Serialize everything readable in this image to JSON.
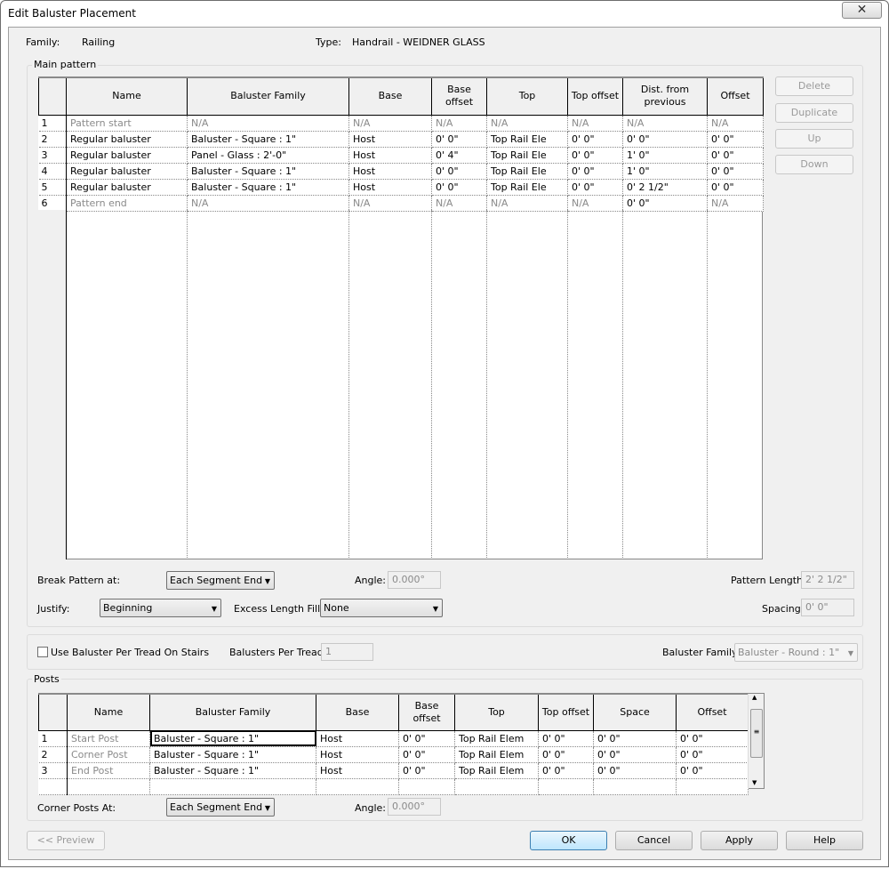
{
  "window": {
    "title": "Edit Baluster Placement",
    "close": "✕"
  },
  "header": {
    "family_label": "Family:",
    "family_value": "Railing",
    "type_label": "Type:",
    "type_value": "Handrail - WEIDNER GLASS"
  },
  "main_pattern": {
    "label": "Main pattern",
    "columns": [
      "Name",
      "Baluster Family",
      "Base",
      "Base offset",
      "Top",
      "Top offset",
      "Dist. from previous",
      "Offset"
    ],
    "rows": [
      {
        "n": "1",
        "cells": [
          "Pattern start",
          "N/A",
          "N/A",
          "N/A",
          "N/A",
          "N/A",
          "N/A",
          "N/A"
        ],
        "gray": [
          0,
          1,
          2,
          3,
          4,
          5,
          6,
          7
        ]
      },
      {
        "n": "2",
        "cells": [
          "Regular baluster",
          "Baluster - Square : 1\"",
          "Host",
          "0'  0\"",
          "Top Rail Ele",
          "0'  0\"",
          "0'  0\"",
          "0'  0\""
        ],
        "gray": []
      },
      {
        "n": "3",
        "cells": [
          "Regular baluster",
          "Panel - Glass : 2'-0\"",
          "Host",
          "0'  4\"",
          "Top Rail Ele",
          "0'  0\"",
          "1'  0\"",
          "0'  0\""
        ],
        "gray": []
      },
      {
        "n": "4",
        "cells": [
          "Regular baluster",
          "Baluster - Square : 1\"",
          "Host",
          "0'  0\"",
          "Top Rail Ele",
          "0'  0\"",
          "1'  0\"",
          "0'  0\""
        ],
        "gray": []
      },
      {
        "n": "5",
        "cells": [
          "Regular baluster",
          "Baluster - Square : 1\"",
          "Host",
          "0'  0\"",
          "Top Rail Ele",
          "0'  0\"",
          "0'  2 1/2\"",
          "0'  0\""
        ],
        "gray": []
      },
      {
        "n": "6",
        "cells": [
          "Pattern end",
          "N/A",
          "N/A",
          "N/A",
          "N/A",
          "N/A",
          "0'  0\"",
          "N/A"
        ],
        "gray": [
          0,
          1,
          2,
          3,
          4,
          5,
          7
        ]
      }
    ],
    "buttons": {
      "delete": "Delete",
      "duplicate": "Duplicate",
      "up": "Up",
      "down": "Down"
    },
    "break_label": "Break Pattern at:",
    "break_value": "Each Segment End",
    "angle_label": "Angle:",
    "angle_value": "0.000°",
    "pattern_length_label": "Pattern Length:",
    "pattern_length_value": "2'  2 1/2\"",
    "justify_label": "Justify:",
    "justify_value": "Beginning",
    "excess_label": "Excess Length Fill :",
    "excess_value": "None",
    "spacing_label": "Spacing:",
    "spacing_value": "0'  0\""
  },
  "stairs": {
    "checkbox_label": "Use Baluster Per Tread On Stairs",
    "checked": false,
    "per_tread_label": "Balusters Per Tread:",
    "per_tread_value": "1",
    "family_label": "Baluster Family:",
    "family_value": "Baluster - Round : 1\""
  },
  "posts": {
    "label": "Posts",
    "columns": [
      "Name",
      "Baluster Family",
      "Base",
      "Base offset",
      "Top",
      "Top offset",
      "Space",
      "Offset"
    ],
    "rows": [
      {
        "n": "1",
        "cells": [
          "Start Post",
          "Baluster - Square : 1\"",
          "Host",
          "0'  0\"",
          "Top Rail Elem",
          "0'  0\"",
          "0'  0\"",
          "0'  0\""
        ]
      },
      {
        "n": "2",
        "cells": [
          "Corner Post",
          "Baluster - Square : 1\"",
          "Host",
          "0'  0\"",
          "Top Rail Elem",
          "0'  0\"",
          "0'  0\"",
          "0'  0\""
        ]
      },
      {
        "n": "3",
        "cells": [
          "End Post",
          "Baluster - Square : 1\"",
          "Host",
          "0'  0\"",
          "Top Rail Elem",
          "0'  0\"",
          "0'  0\"",
          "0'  0\""
        ]
      }
    ],
    "corner_label": "Corner Posts At:",
    "corner_value": "Each Segment End",
    "angle_label": "Angle:",
    "angle_value": "0.000°"
  },
  "footer": {
    "preview": "<< Preview",
    "ok": "OK",
    "cancel": "Cancel",
    "apply": "Apply",
    "help": "Help"
  }
}
